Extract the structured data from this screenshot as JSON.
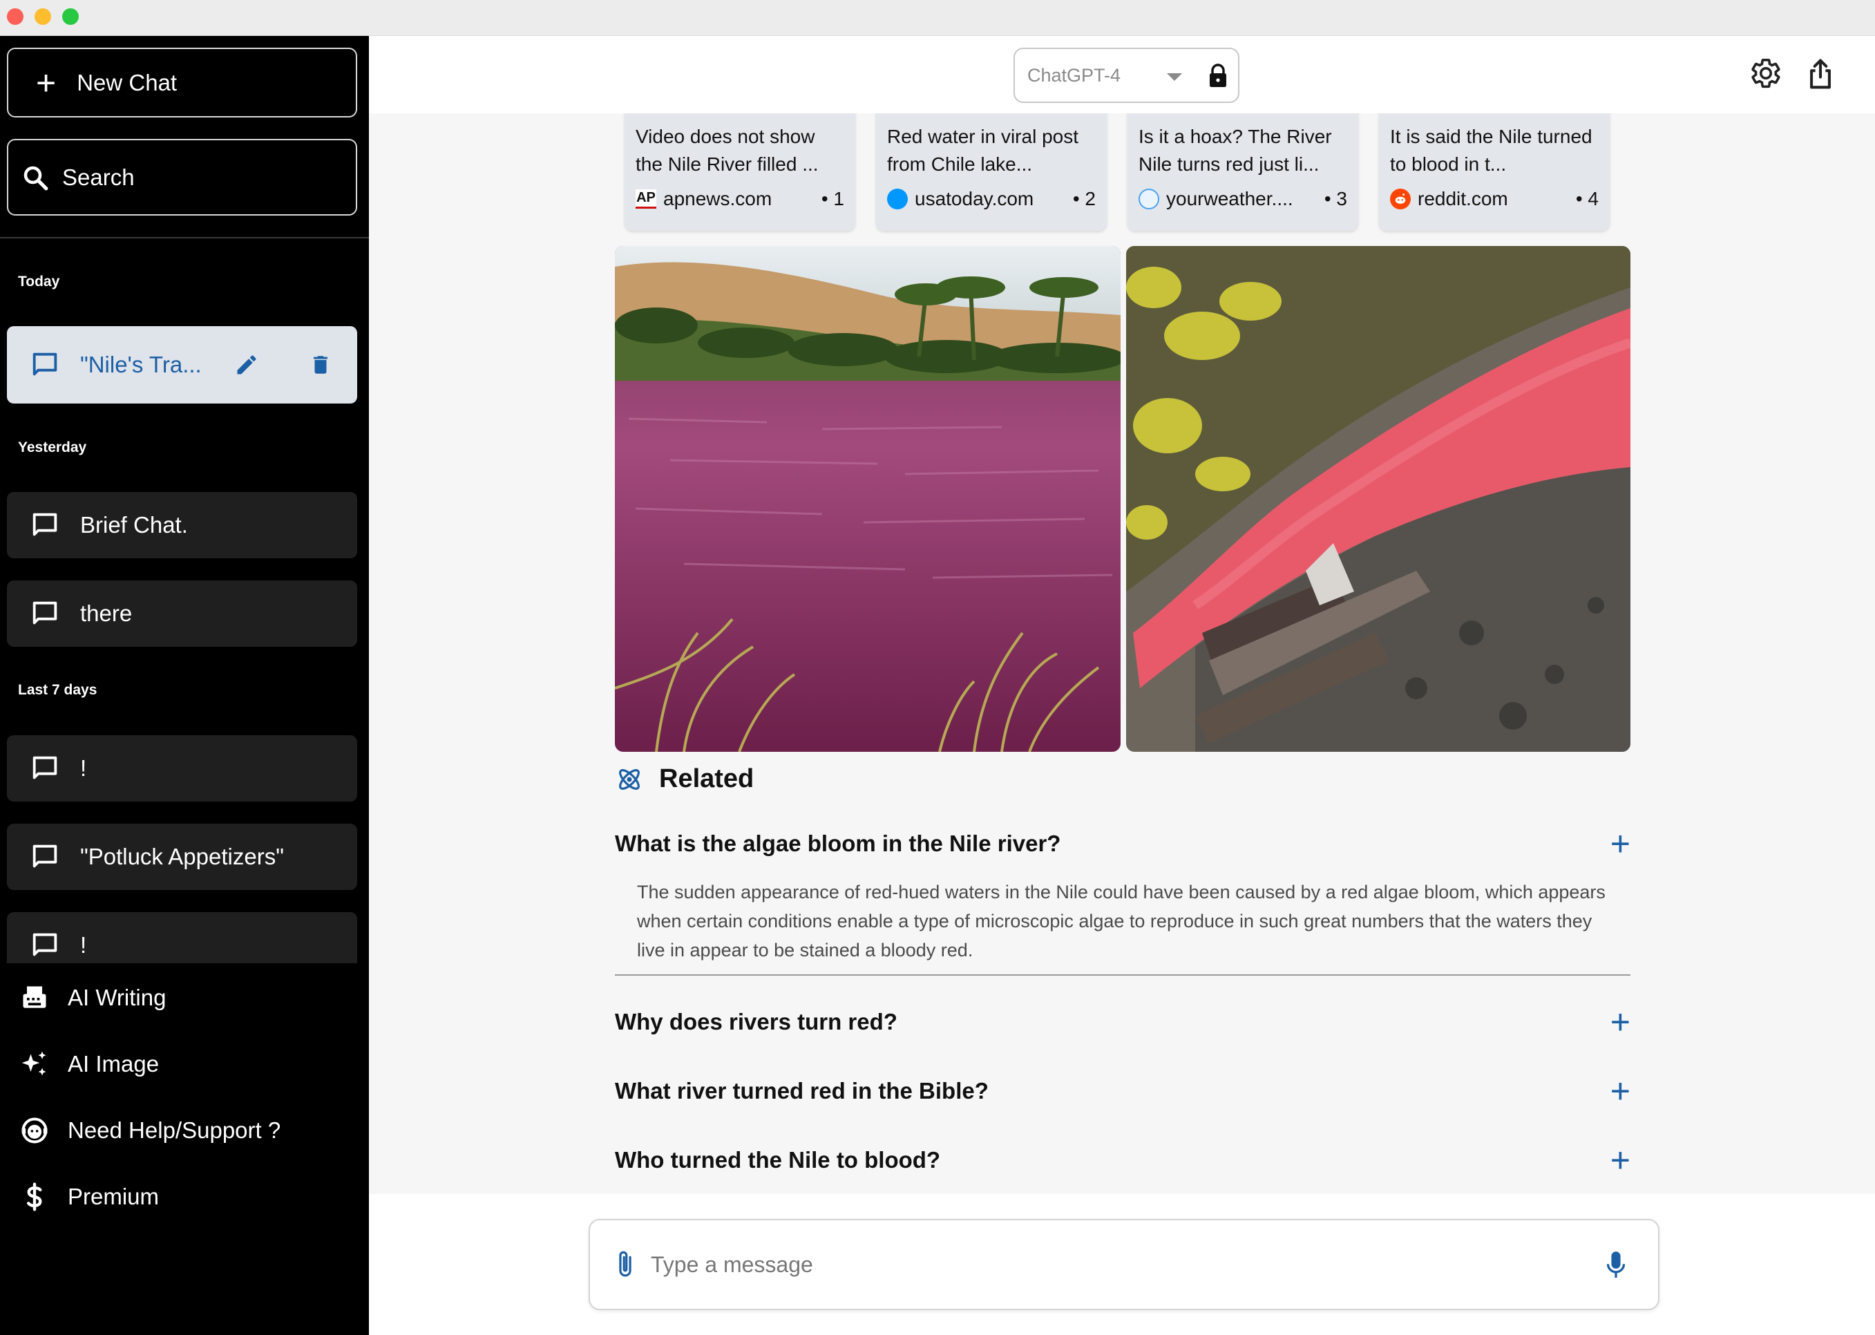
{
  "sidebar": {
    "new_chat_label": "New Chat",
    "search_label": "Search",
    "sections": {
      "today": "Today",
      "yesterday": "Yesterday",
      "last7": "Last 7 days"
    },
    "chats": {
      "active": "\"Nile's Tra...",
      "brief": "Brief Chat.",
      "there": "there",
      "excl1": "!",
      "potluck": "\"Potluck Appetizers\"",
      "excl2": "!"
    },
    "tools": {
      "writing": "AI Writing",
      "image": "AI Image",
      "help": "Need Help/Support ?",
      "premium": "Premium"
    }
  },
  "header": {
    "model": "ChatGPT-4"
  },
  "sources": [
    {
      "title": "Video does not show the Nile River filled ...",
      "domain": "apnews.com",
      "num": "• 1",
      "icon": "ap-logo"
    },
    {
      "title": "Red water in viral post from Chile lake...",
      "domain": "usatoday.com",
      "num": "• 2",
      "icon": "usatoday-logo"
    },
    {
      "title": "Is it a hoax? The River Nile turns red just li...",
      "domain": "yourweather....",
      "num": "• 3",
      "icon": "weather-logo"
    },
    {
      "title": "It is said the Nile turned to blood in t...",
      "domain": "reddit.com",
      "num": "• 4",
      "icon": "reddit-logo"
    }
  ],
  "related": {
    "heading": "Related",
    "questions": [
      "What is the algae bloom in the Nile river?",
      "Why does rivers turn red?",
      "What river turned red in the Bible?",
      "Who turned the Nile to blood?"
    ],
    "answer": "The sudden appearance of red-hued waters in the Nile could have been caused by a red algae bloom, which appears when certain conditions enable a type of microscopic algae to reproduce in such great numbers that the waters they live in appear to be stained a bloody red."
  },
  "composer": {
    "placeholder": "Type a message"
  },
  "colors": {
    "accent": "#1b5fa5",
    "sidebar_bg": "#000000",
    "active_chat_bg": "#dfe3ea"
  }
}
